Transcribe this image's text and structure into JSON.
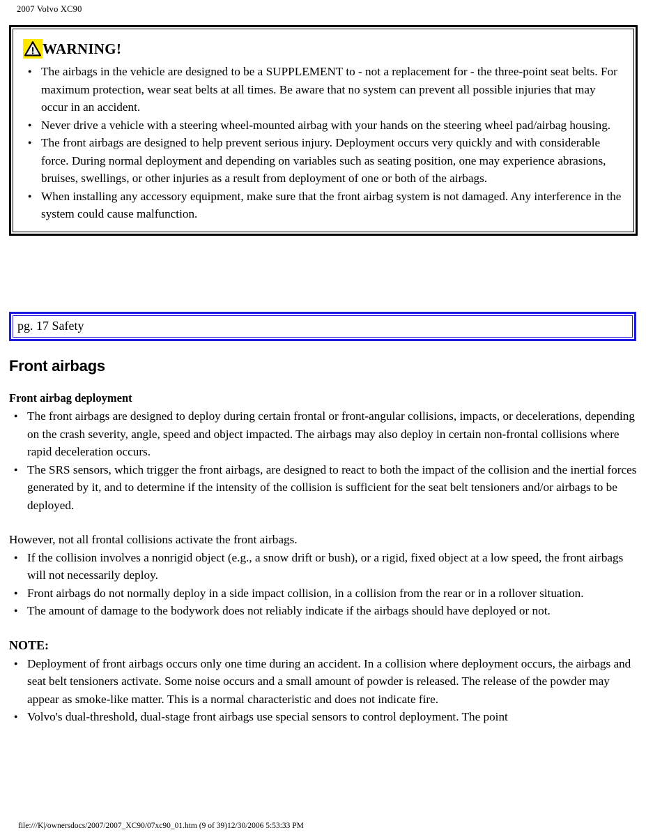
{
  "header": {
    "running_title": "2007 Volvo XC90"
  },
  "warning_box": {
    "icon": "warning-triangle-icon",
    "icon_bg_color": "#ffe800",
    "title": "WARNING!",
    "border_color": "#000000",
    "bullets": [
      "The airbags in the vehicle are designed to be a SUPPLEMENT to - not a replacement for - the three-point seat belts. For maximum protection, wear seat belts at all times. Be aware that no system can prevent all possible injuries that may occur in an accident.",
      "Never drive a vehicle with a steering wheel-mounted airbag with your hands on the steering wheel pad/airbag housing.",
      "The front airbags are designed to help prevent serious injury. Deployment occurs very quickly and with considerable force. During normal deployment and depending on variables such as seating position, one may experience abrasions, bruises, swellings, or other injuries as a result from deployment of one or both of the airbags.",
      "When installing any accessory equipment, make sure that the front airbag system is not damaged. Any interference in the system could cause malfunction."
    ]
  },
  "page_reference": {
    "text": "pg. 17 Safety",
    "border_color": "#1a1ae0"
  },
  "main": {
    "section_title": "Front airbags",
    "deployment": {
      "sub_head": "Front airbag deployment",
      "bullets": [
        "The front airbags are designed to deploy during certain frontal or front-angular collisions, impacts, or decelerations, depending on the crash severity, angle, speed and object impacted. The airbags may also deploy in certain non-frontal collisions where rapid deceleration occurs.",
        "The SRS sensors, which trigger the front airbags, are designed to react to both the impact of the collision and the inertial forces generated by it, and to determine if the intensity of the collision is sufficient for the seat belt tensioners and/or airbags to be deployed."
      ]
    },
    "however": {
      "paragraph": "However, not all frontal collisions activate the front airbags.",
      "bullets": [
        "If the collision involves a nonrigid object (e.g., a snow drift or bush), or a rigid, fixed object at a low speed, the front airbags will not necessarily deploy.",
        "Front airbags do not normally deploy in a side impact collision, in a collision from the rear or in a rollover situation.",
        "The amount of damage to the bodywork does not reliably indicate if the airbags should have deployed or not."
      ]
    },
    "note": {
      "head": "NOTE:",
      "bullets": [
        "Deployment of front airbags occurs only one time during an accident. In a collision where deployment occurs, the airbags and seat belt tensioners activate. Some noise occurs and a small amount of powder is released. The release of the powder may appear as smoke-like matter. This is a normal characteristic and does not indicate fire.",
        "Volvo's dual-threshold, dual-stage front airbags use special sensors to control deployment. The point"
      ]
    }
  },
  "footer": {
    "text": "file:///K|/ownersdocs/2007/2007_XC90/07xc90_01.htm (9 of 39)12/30/2006 5:53:33 PM"
  }
}
